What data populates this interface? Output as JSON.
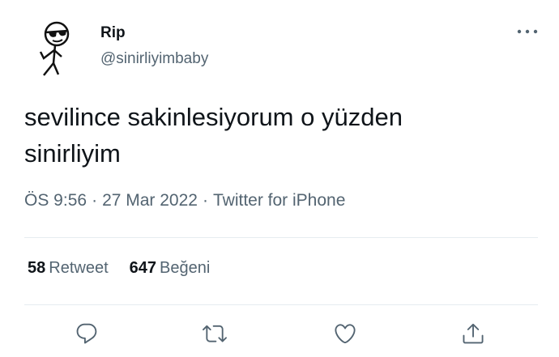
{
  "author": {
    "name": "Rip",
    "handle": "@sinirliyimbaby"
  },
  "tweet": {
    "text": "sevilince sakinlesiyorum o yüzden\nsinirliyim",
    "time": "ÖS 9:56",
    "date": "27 Mar 2022",
    "source": "Twitter for iPhone",
    "separator": "·"
  },
  "stats": {
    "retweets_count": "58",
    "retweets_label": "Retweet",
    "likes_count": "647",
    "likes_label": "Beğeni"
  },
  "icons": {
    "more": "more-horizontal-icon",
    "reply": "reply-icon",
    "retweet": "retweet-icon",
    "like": "heart-icon",
    "share": "share-icon"
  },
  "colors": {
    "text": "#0f1419",
    "secondary": "#536471",
    "divider": "#e6ecf0"
  }
}
